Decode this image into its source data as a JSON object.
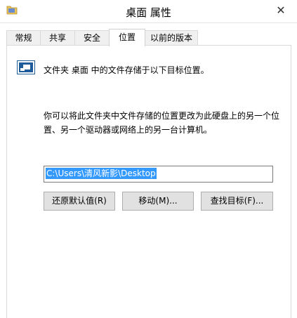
{
  "window": {
    "title": "桌面 属性",
    "close_glyph": "✕"
  },
  "tabs": [
    {
      "label": "常规",
      "active": false
    },
    {
      "label": "共享",
      "active": false
    },
    {
      "label": "安全",
      "active": false
    },
    {
      "label": "位置",
      "active": true
    },
    {
      "label": "以前的版本",
      "active": false
    }
  ],
  "location": {
    "description": "文件夹 桌面 中的文件存储于以下目标位置。",
    "paragraph": "你可以将此文件夹中文件存储的位置更改为此硬盘上的另一个位置、另一个驱动器或网络上的另一台计算机。",
    "path_value": "C:\\Users\\清风新影\\Desktop"
  },
  "buttons": {
    "restore": "还原默认值(R)",
    "move": "移动(M)...",
    "find_target": "查找目标(F)..."
  },
  "colors": {
    "selection": "#3399ff",
    "button_face": "#e1e1e1",
    "icon_blue": "#1e5b9a"
  },
  "icons": {
    "title": "folder-icon",
    "location": "folder-location-icon",
    "close": "close-icon"
  }
}
